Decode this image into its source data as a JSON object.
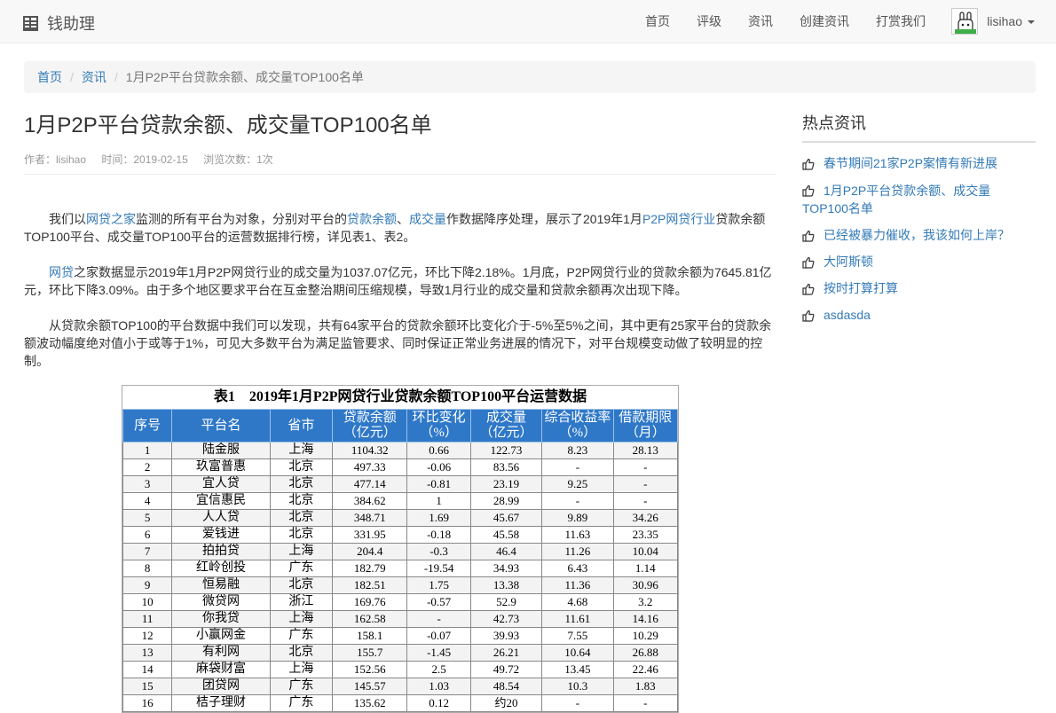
{
  "navbar": {
    "brand": "钱助理",
    "links": [
      "首页",
      "评级",
      "资讯",
      "创建资讯",
      "打赏我们"
    ],
    "user": "lisihao"
  },
  "breadcrumb": {
    "home": "首页",
    "section": "资讯",
    "current": "1月P2P平台贷款余额、成交量TOP100名单"
  },
  "article": {
    "title": "1月P2P平台贷款余额、成交量TOP100名单",
    "author": "作者：lisihao",
    "time": "时间：2019-02-15",
    "views": "浏览次数：1次",
    "p1": {
      "t1": "我们以",
      "l1": "网贷之家",
      "t2": "监测的所有平台为对象，分别对平台的",
      "l2": "贷款余额",
      "t3": "、",
      "l3": "成交量",
      "t4": "作数据降序处理，展示了2019年1月",
      "l4": "P2P网贷行业",
      "t5": "贷款余额TOP100平台、成交量TOP100平台的运营数据排行榜，详见表1、表2。"
    },
    "p2": {
      "l1": "网贷",
      "t1": "之家数据显示2019年1月P2P网贷行业的成交量为1037.07亿元，环比下降2.18%。1月底，P2P网贷行业的贷款余额为7645.81亿元，环比下降3.09%。由于多个地区要求平台在互金整治期间压缩规模，导致1月行业的成交量和贷款余额再次出现下降。"
    },
    "p3": "从贷款余额TOP100的平台数据中我们可以发现，共有64家平台的贷款余额环比变化介于-5%至5%之间，其中更有25家平台的贷款余额波动幅度绝对值小于或等于1%，可见大多数平台为满足监管要求、同时保证正常业务进展的情况下，对平台规模变动做了较明显的控制。"
  },
  "table": {
    "caption": "表1　2019年1月P2P网贷行业贷款余额TOP100平台运营数据",
    "headers": [
      [
        "序号",
        ""
      ],
      [
        "平台名",
        ""
      ],
      [
        "省市",
        ""
      ],
      [
        "贷款余额",
        "（亿元）"
      ],
      [
        "环比变化",
        "（%）"
      ],
      [
        "成交量",
        "（亿元）"
      ],
      [
        "综合收益率",
        "（%）"
      ],
      [
        "借款期限",
        "（月）"
      ]
    ],
    "rows": [
      [
        "1",
        "陆金服",
        "上海",
        "1104.32",
        "0.66",
        "122.73",
        "8.23",
        "28.13"
      ],
      [
        "2",
        "玖富普惠",
        "北京",
        "497.33",
        "-0.06",
        "83.56",
        "-",
        "-"
      ],
      [
        "3",
        "宜人贷",
        "北京",
        "477.14",
        "-0.81",
        "23.19",
        "9.25",
        "-"
      ],
      [
        "4",
        "宜信惠民",
        "北京",
        "384.62",
        "1",
        "28.99",
        "-",
        "-"
      ],
      [
        "5",
        "人人贷",
        "北京",
        "348.71",
        "1.69",
        "45.67",
        "9.89",
        "34.26"
      ],
      [
        "6",
        "爱钱进",
        "北京",
        "331.95",
        "-0.18",
        "45.58",
        "11.63",
        "23.35"
      ],
      [
        "7",
        "拍拍贷",
        "上海",
        "204.4",
        "-0.3",
        "46.4",
        "11.26",
        "10.04"
      ],
      [
        "8",
        "红岭创投",
        "广东",
        "182.79",
        "-19.54",
        "34.93",
        "6.43",
        "1.14"
      ],
      [
        "9",
        "恒易融",
        "北京",
        "182.51",
        "1.75",
        "13.38",
        "11.36",
        "30.96"
      ],
      [
        "10",
        "微贷网",
        "浙江",
        "169.76",
        "-0.57",
        "52.9",
        "4.68",
        "3.2"
      ],
      [
        "11",
        "你我贷",
        "上海",
        "162.58",
        "-",
        "42.73",
        "11.61",
        "14.16"
      ],
      [
        "12",
        "小赢网金",
        "广东",
        "158.1",
        "-0.07",
        "39.93",
        "7.55",
        "10.29"
      ],
      [
        "13",
        "有利网",
        "北京",
        "155.7",
        "-1.45",
        "26.21",
        "10.64",
        "26.88"
      ],
      [
        "14",
        "麻袋财富",
        "上海",
        "152.56",
        "2.5",
        "49.72",
        "13.45",
        "22.46"
      ],
      [
        "15",
        "团贷网",
        "广东",
        "145.57",
        "1.03",
        "48.54",
        "10.3",
        "1.83"
      ],
      [
        "16",
        "桔子理财",
        "广东",
        "135.62",
        "0.12",
        "约20",
        "-",
        "-"
      ]
    ]
  },
  "sidebar": {
    "title": "热点资讯",
    "items": [
      "春节期间21家P2P案情有新进展",
      "1月P2P平台贷款余额、成交量TOP100名单",
      "已经被暴力催收，我该如何上岸？",
      "大阿斯顿",
      "按时打算打算",
      "asdasda"
    ]
  },
  "colors": {
    "link": "#337ab7",
    "table_header": "#2f78c8"
  },
  "icons": [
    "table-icon",
    "avatar-icon",
    "caret-down-icon",
    "thumbs-up-icon"
  ]
}
